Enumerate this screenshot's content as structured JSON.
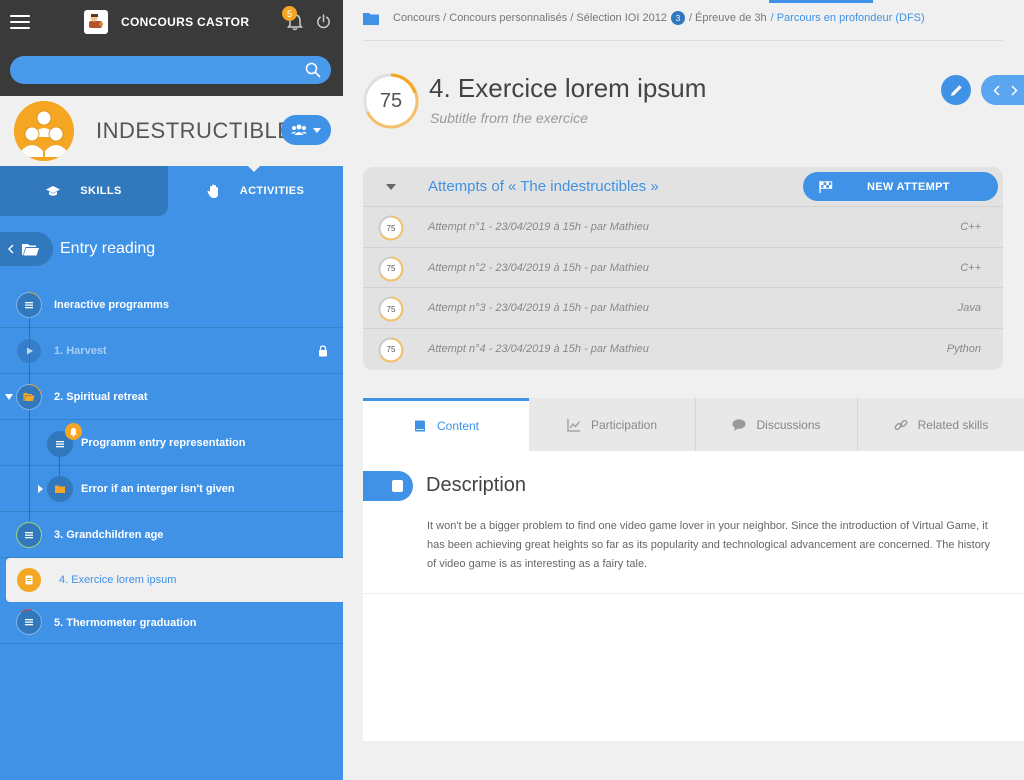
{
  "app": {
    "title": "CONCOURS CASTOR",
    "notification_count": "5"
  },
  "search": {
    "placeholder": ""
  },
  "team": {
    "name": "INDESTRUCTIBLES"
  },
  "sidebar_tabs": {
    "skills": "SKILLS",
    "activities": "ACTIVITIES"
  },
  "entry": {
    "title": "Entry reading"
  },
  "tree": {
    "items": [
      {
        "label": "Ineractive programms"
      },
      {
        "label": "1. Harvest"
      },
      {
        "label": "2. Spiritual retreat"
      },
      {
        "label": "Programm entry representation"
      },
      {
        "label": "Error if an interger isn't given"
      },
      {
        "label": "3. Grandchildren age"
      },
      {
        "label": "4. Exercice lorem ipsum"
      },
      {
        "label": "5. Thermometer graduation"
      }
    ]
  },
  "breadcrumb": {
    "part1": "Concours / Concours personnalisés / Sélection IOI 2012",
    "badge": "3",
    "part2": "/ Épreuve de 3h",
    "current": "/ Parcours en profondeur (DFS)"
  },
  "exercise": {
    "score": "75",
    "title": "4. Exercice lorem ipsum",
    "subtitle": "Subtitle from the exercice"
  },
  "attempts": {
    "title": "Attempts of « The indestructibles »",
    "new_button": "NEW ATTEMPT",
    "rows": [
      {
        "score": "75",
        "text": "Attempt n°1 - 23/04/2019 à 15h - par Mathieu",
        "lang": "C++"
      },
      {
        "score": "75",
        "text": "Attempt n°2 - 23/04/2019 à 15h - par Mathieu",
        "lang": "C++"
      },
      {
        "score": "75",
        "text": "Attempt n°3 - 23/04/2019 à 15h - par Mathieu",
        "lang": "Java"
      },
      {
        "score": "75",
        "text": "Attempt n°4 - 23/04/2019 à 15h - par Mathieu",
        "lang": "Python"
      }
    ]
  },
  "content_tabs": {
    "content": "Content",
    "participation": "Participation",
    "discussions": "Discussions",
    "related": "Related skills"
  },
  "description": {
    "title": "Description",
    "text": "It won't be a bigger problem to find one video game lover in your neighbor. Since the introduction of Virtual Game, it has been achieving great heights so far as its popularity and technological advancement are concerned. The history of video game is as interesting as a fairy tale."
  },
  "colors": {
    "primary": "#3f92e6",
    "primary_dark": "#3278bd",
    "accent": "#f5a623",
    "topbar": "#3a3a3a"
  }
}
